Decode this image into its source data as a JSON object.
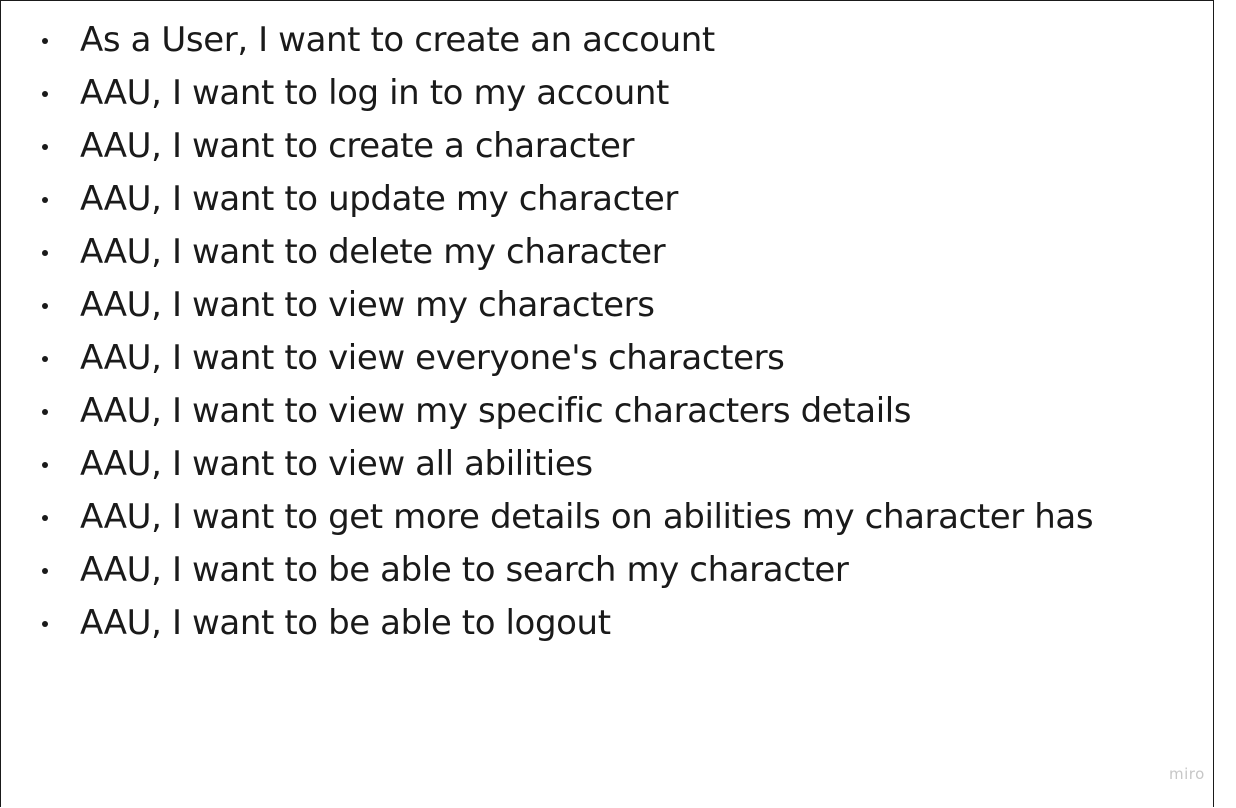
{
  "stories": [
    "As a User, I want to create an account",
    "AAU, I want to log in to my account",
    "AAU, I want to create a character",
    "AAU, I want to update my character",
    "AAU, I want to delete my character",
    "AAU, I want to view my characters",
    "AAU, I want to view everyone's characters",
    "AAU, I want to view my specific characters details",
    "AAU, I want to view all abilities",
    "AAU, I want to get more details on abilities my character has",
    "AAU, I want to be able to search my character",
    "AAU, I want to be able to logout"
  ],
  "watermark": "miro"
}
